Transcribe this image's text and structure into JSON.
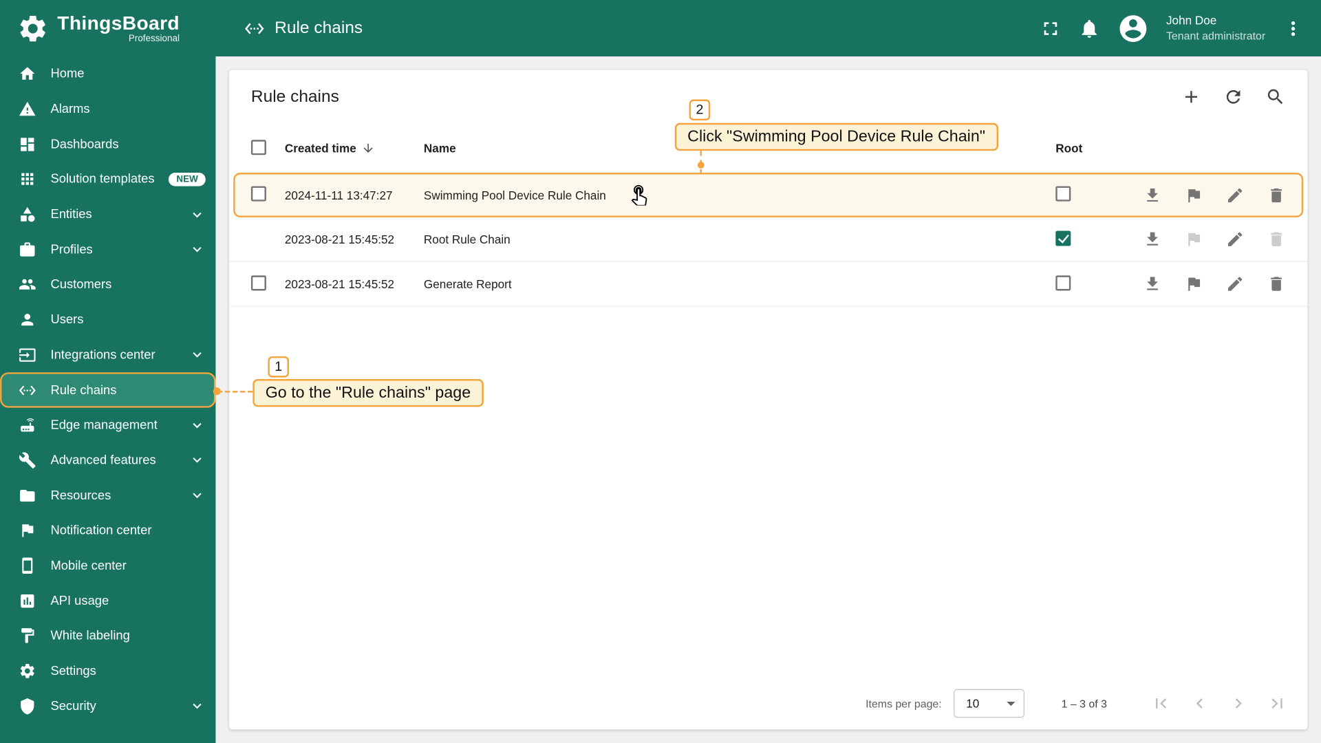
{
  "colors": {
    "primary": "#17735F",
    "primary_sel": "#2F8A74",
    "accent": "#F2A53C",
    "ann_bg": "#FCF3D7",
    "row_hl": "#FDF8EC"
  },
  "brand": {
    "title": "ThingsBoard",
    "subtitle": "Professional"
  },
  "topbar": {
    "page_title": "Rule chains",
    "user": {
      "name": "John Doe",
      "role": "Tenant administrator"
    }
  },
  "sidebar": {
    "items": [
      {
        "label": "Home"
      },
      {
        "label": "Alarms"
      },
      {
        "label": "Dashboards"
      },
      {
        "label": "Solution templates",
        "badge": "NEW"
      },
      {
        "label": "Entities",
        "has_submenu": true
      },
      {
        "label": "Profiles",
        "has_submenu": true
      },
      {
        "label": "Customers"
      },
      {
        "label": "Users"
      },
      {
        "label": "Integrations center",
        "has_submenu": true
      },
      {
        "label": "Rule chains",
        "selected": true
      },
      {
        "label": "Edge management",
        "has_submenu": true
      },
      {
        "label": "Advanced features",
        "has_submenu": true
      },
      {
        "label": "Resources",
        "has_submenu": true
      },
      {
        "label": "Notification center"
      },
      {
        "label": "Mobile center"
      },
      {
        "label": "API usage"
      },
      {
        "label": "White labeling"
      },
      {
        "label": "Settings"
      },
      {
        "label": "Security",
        "has_submenu": true
      }
    ]
  },
  "main": {
    "title": "Rule chains",
    "table": {
      "headers": {
        "created_time": "Created time",
        "name": "Name",
        "root": "Root"
      },
      "rows": [
        {
          "created": "2024-11-11 13:47:27",
          "name": "Swimming Pool Device Rule Chain",
          "root": false
        },
        {
          "created": "2023-08-21 15:45:52",
          "name": "Root Rule Chain",
          "root": true
        },
        {
          "created": "2023-08-21 15:45:52",
          "name": "Generate Report",
          "root": false
        }
      ]
    },
    "pagination": {
      "items_per_page_label": "Items per page:",
      "items_per_page": "10",
      "range": "1 – 3 of 3"
    }
  },
  "annotations": {
    "step1": {
      "number": "1",
      "text": "Go to the \"Rule chains\" page"
    },
    "step2": {
      "number": "2",
      "text": "Click \"Swimming Pool Device Rule Chain\""
    }
  }
}
